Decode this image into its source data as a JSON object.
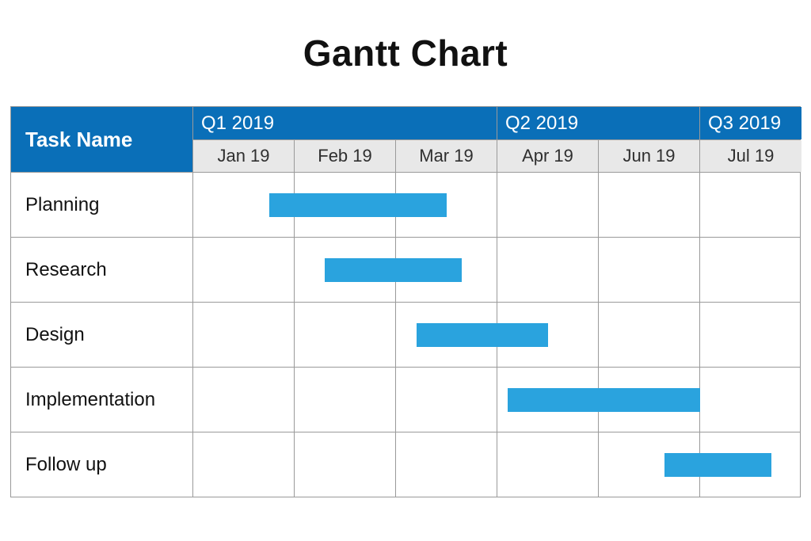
{
  "title": "Gantt Chart",
  "header": {
    "task_label": "Task Name",
    "quarters": [
      {
        "label": "Q1 2019",
        "span": 3
      },
      {
        "label": "Q2 2019",
        "span": 2
      },
      {
        "label": "Q3 2019",
        "span": 1
      }
    ],
    "months": [
      "Jan 19",
      "Feb 19",
      "Mar 19",
      "Apr 19",
      "Jun 19",
      "Jul 19"
    ]
  },
  "tasks": [
    {
      "name": "Planning",
      "start": 0.75,
      "duration": 1.75
    },
    {
      "name": "Research",
      "start": 1.3,
      "duration": 1.35
    },
    {
      "name": "Design",
      "start": 2.2,
      "duration": 1.3
    },
    {
      "name": "Implementation",
      "start": 3.1,
      "duration": 1.9
    },
    {
      "name": "Follow up",
      "start": 4.65,
      "duration": 1.05
    }
  ],
  "colors": {
    "header_bg": "#0a6fb8",
    "month_bg": "#e8e8e8",
    "bar": "#2aa3de",
    "grid": "#9a9a9a"
  },
  "chart_data": {
    "type": "bar",
    "orientation": "horizontal-gantt",
    "title": "Gantt Chart",
    "x_unit": "month-index (0 = start of Jan 19 column)",
    "x_columns": [
      "Jan 19",
      "Feb 19",
      "Mar 19",
      "Apr 19",
      "Jun 19",
      "Jul 19"
    ],
    "x_groups": [
      {
        "label": "Q1 2019",
        "columns": [
          "Jan 19",
          "Feb 19",
          "Mar 19"
        ]
      },
      {
        "label": "Q2 2019",
        "columns": [
          "Apr 19",
          "Jun 19"
        ]
      },
      {
        "label": "Q3 2019",
        "columns": [
          "Jul 19"
        ]
      }
    ],
    "series": [
      {
        "name": "Planning",
        "start": 0.75,
        "end": 2.5
      },
      {
        "name": "Research",
        "start": 1.3,
        "end": 2.65
      },
      {
        "name": "Design",
        "start": 2.2,
        "end": 3.5
      },
      {
        "name": "Implementation",
        "start": 3.1,
        "end": 5.0
      },
      {
        "name": "Follow up",
        "start": 4.65,
        "end": 5.7
      }
    ],
    "xlim": [
      0,
      6
    ]
  }
}
